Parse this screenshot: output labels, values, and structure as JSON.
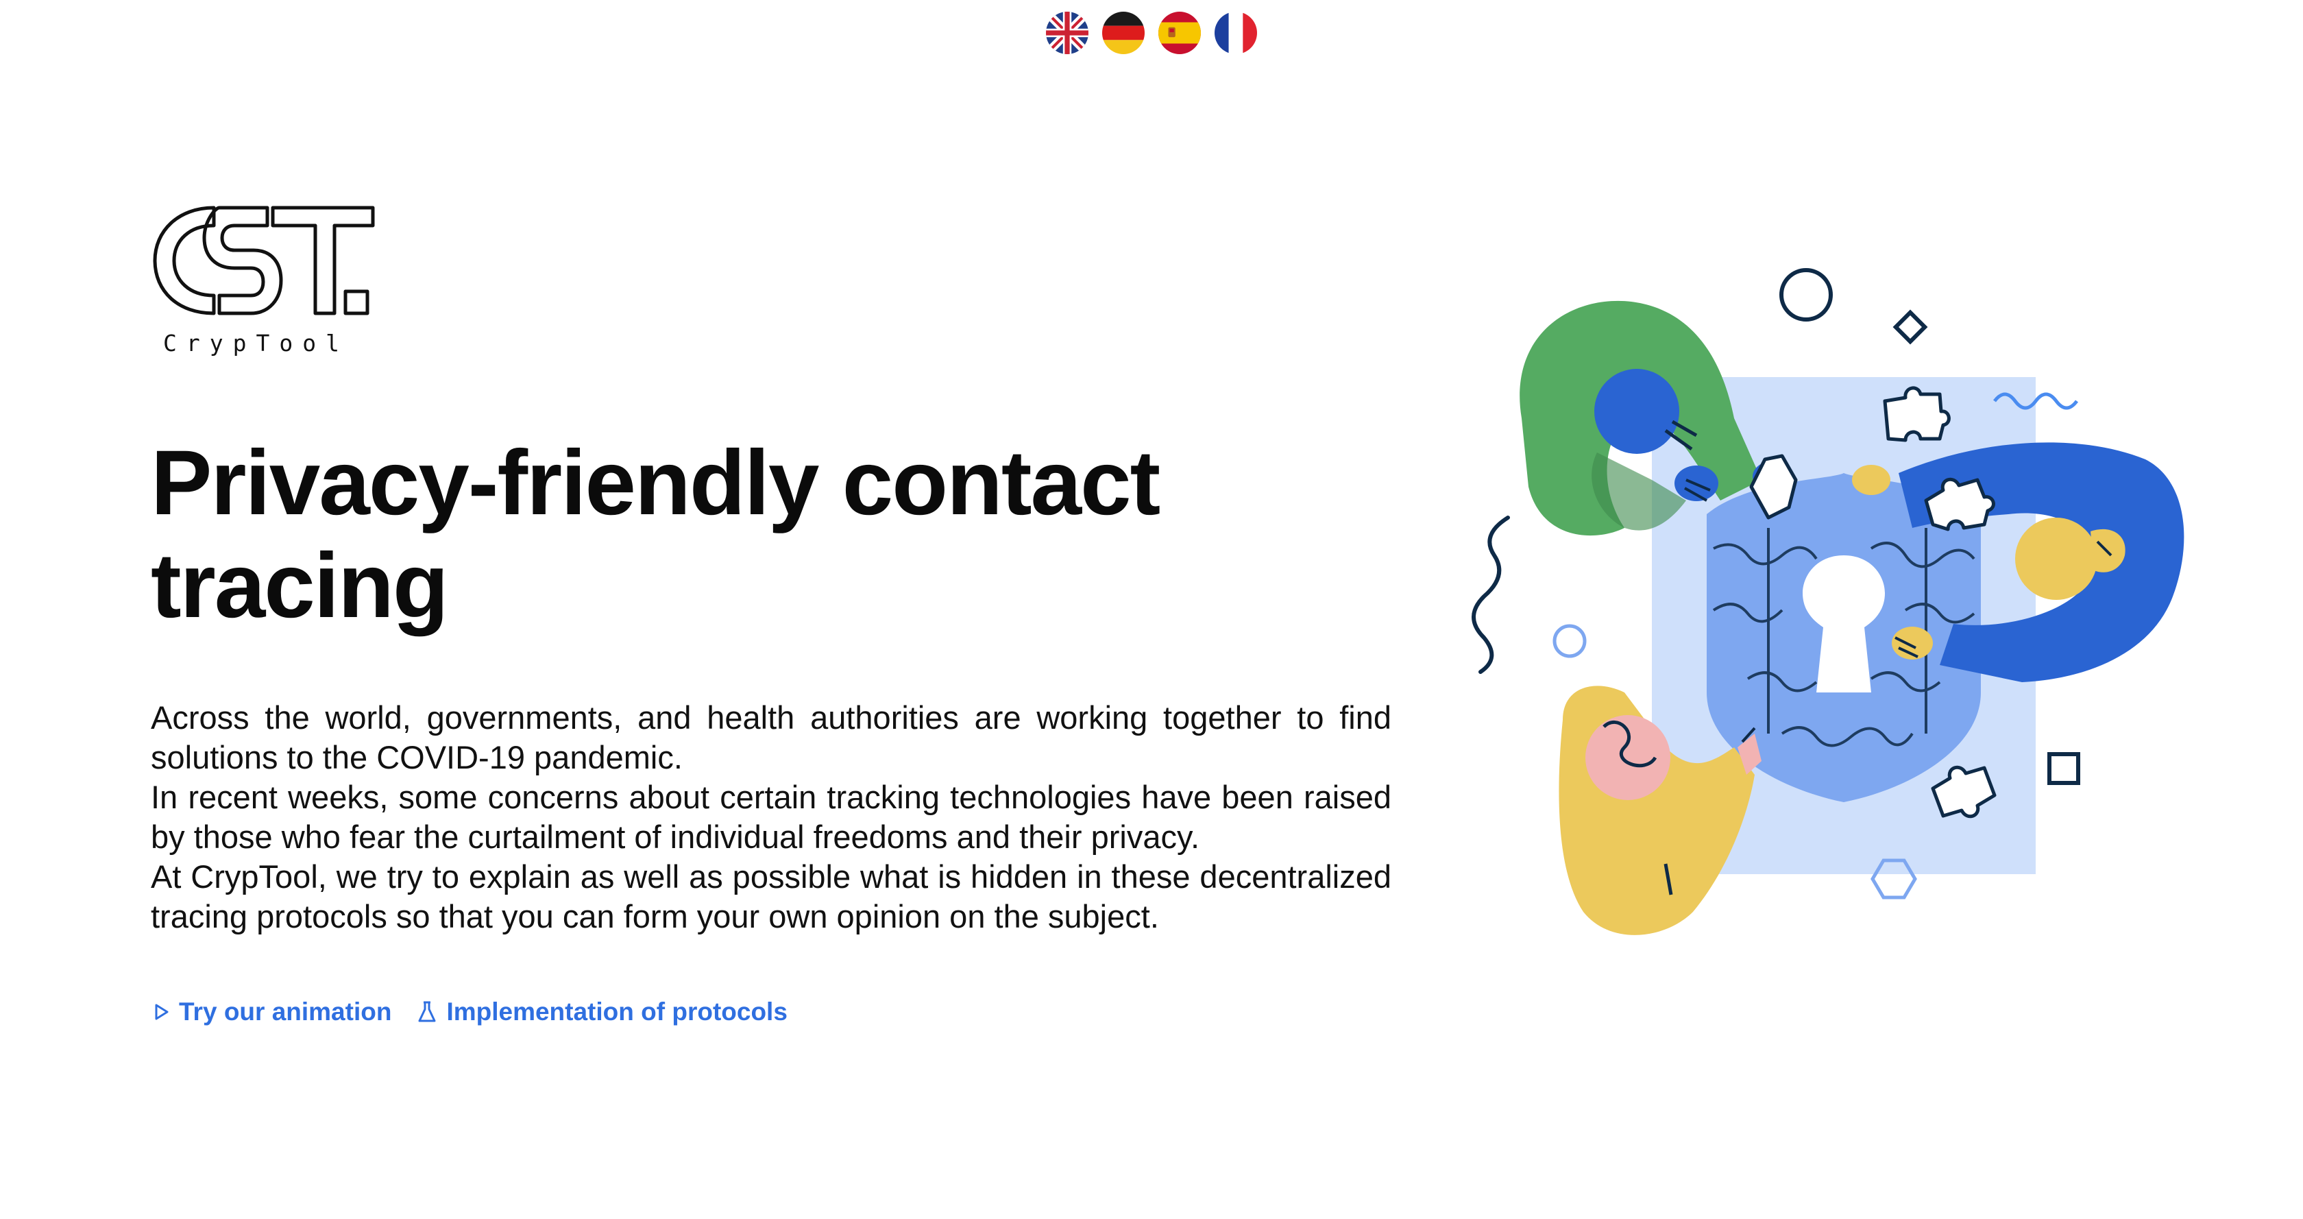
{
  "languages": [
    {
      "code": "en",
      "name": "English"
    },
    {
      "code": "de",
      "name": "Deutsch"
    },
    {
      "code": "es",
      "name": "Español"
    },
    {
      "code": "fr",
      "name": "Français"
    }
  ],
  "logo": {
    "wordmark": "CrypTool"
  },
  "hero": {
    "title": "Privacy-friendly contact tracing",
    "paragraphs": [
      "Across the world, governments, and health authorities are working together to find solutions to the COVID-19 pandemic.",
      "In recent weeks, some concerns about certain tracking technologies have been raised by those who fear the curtailment of individual freedoms and their privacy.",
      "At CrypTool, we try to explain as well as possible what is hidden in these decentralized tracing protocols so that you can form your own opinion on the subject."
    ]
  },
  "links": [
    {
      "label": "Try our animation",
      "icon": "play-icon"
    },
    {
      "label": "Implementation of protocols",
      "icon": "flask-icon"
    }
  ],
  "colors": {
    "link": "#2f6fe0",
    "green": "#55ab62",
    "blue": "#2a64d2",
    "yellow": "#ecc95c",
    "pink": "#f2b3b3",
    "light_blue": "#cfe0fb",
    "navy": "#0e2a47"
  }
}
